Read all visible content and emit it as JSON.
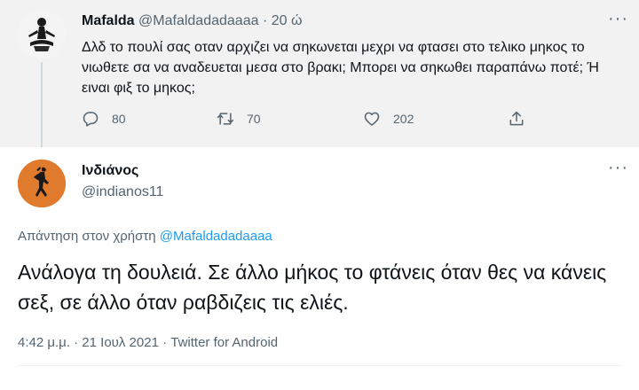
{
  "parent_tweet": {
    "name": "Mafalda",
    "handle": "@Mafaldadadaaaa",
    "separator": "·",
    "time": "20 ώ",
    "text": "Δλδ το πουλί σας οταν αρχιζει να σηκωνεται μεχρι να φτασει στο τελικο μηκος το νιωθετε σα να αναδευεται μεσα στο βρακι; Μπορει να σηκωθει παραπάνω ποτέ; Ή ειναι φιξ το μηκος;",
    "actions": {
      "reply_count": "80",
      "retweet_count": "70",
      "like_count": "202"
    },
    "more_icon": "more-horizontal-icon"
  },
  "main_tweet": {
    "name": "Ινδιάνος",
    "handle": "@indianos11",
    "reply_prefix": "Απάντηση στον χρήστη",
    "reply_mention": "@Mafaldadadaaaa",
    "text": "Ανάλογα τη δουλειά. Σε άλλο μήκος το φτάνεις όταν θες να κάνεις σεξ, σε άλλο όταν ραβδιζεις τις ελιές.",
    "meta": "4:42 μ.μ. · 21 Ιουλ 2021 · Twitter for Android",
    "more_icon": "more-horizontal-icon"
  },
  "colors": {
    "mention_blue": "#1d9bf0",
    "secondary_text": "#536471",
    "parent_bg": "#f2f2f2",
    "avatar_orange": "#e07a2c"
  }
}
